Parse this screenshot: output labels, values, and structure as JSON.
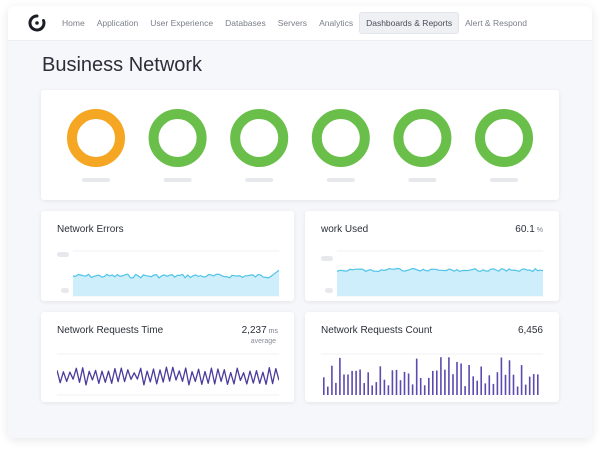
{
  "nav": {
    "items": [
      {
        "label": "Home",
        "active": false
      },
      {
        "label": "Application",
        "active": false
      },
      {
        "label": "User Experience",
        "active": false
      },
      {
        "label": "Databases",
        "active": false
      },
      {
        "label": "Servers",
        "active": false
      },
      {
        "label": "Analytics",
        "active": false
      },
      {
        "label": "Dashboards & Reports",
        "active": true
      },
      {
        "label": "Alert & Respond",
        "active": false
      }
    ]
  },
  "page": {
    "title": "Business Network"
  },
  "status_rings": [
    {
      "status": "warning",
      "color": "#f5a623"
    },
    {
      "status": "ok",
      "color": "#6abf4b"
    },
    {
      "status": "ok",
      "color": "#6abf4b"
    },
    {
      "status": "ok",
      "color": "#6abf4b"
    },
    {
      "status": "ok",
      "color": "#6abf4b"
    },
    {
      "status": "ok",
      "color": "#6abf4b"
    }
  ],
  "cards": {
    "errors": {
      "title": "Network Errors"
    },
    "used": {
      "title": "work Used",
      "value": "60.1",
      "unit": "%"
    },
    "req_time": {
      "title": "Network Requests Time",
      "value": "2,237",
      "unit": "ms",
      "sub": "average"
    },
    "req_count": {
      "title": "Network Requests Count",
      "value": "6,456"
    }
  },
  "colors": {
    "area_line": "#4fc3e8",
    "area_fill": "#cdeefa",
    "line_purple": "#4b3b9c",
    "bar_purple": "#5b4bb0"
  }
}
